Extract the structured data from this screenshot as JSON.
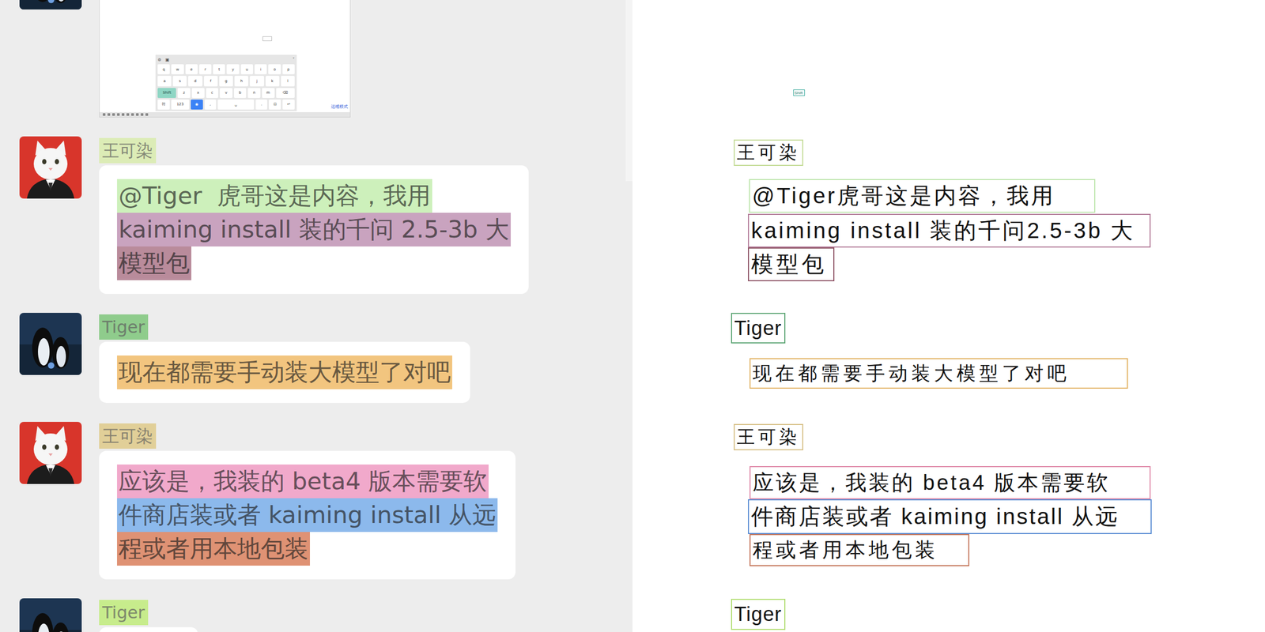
{
  "chat": {
    "messages": [
      {
        "kind": "image",
        "avatar": "penguin",
        "image": {
          "keyboard": {
            "toolbar": [
              "⊚",
              "▣",
              "˅"
            ],
            "rows": [
              {
                "keys": [
                  {
                    "label": "q"
                  },
                  {
                    "label": "w"
                  },
                  {
                    "label": "e"
                  },
                  {
                    "label": "r"
                  },
                  {
                    "label": "t"
                  },
                  {
                    "label": "y"
                  },
                  {
                    "label": "u"
                  },
                  {
                    "label": "i"
                  },
                  {
                    "label": "o"
                  },
                  {
                    "label": "p"
                  }
                ]
              },
              {
                "keys": [
                  {
                    "label": "a"
                  },
                  {
                    "label": "s"
                  },
                  {
                    "label": "d"
                  },
                  {
                    "label": "f"
                  },
                  {
                    "label": "g"
                  },
                  {
                    "label": "h"
                  },
                  {
                    "label": "j"
                  },
                  {
                    "label": "k"
                  },
                  {
                    "label": "l"
                  }
                ]
              },
              {
                "keys": [
                  {
                    "label": "Shift",
                    "color": "#8fd6c4"
                  },
                  {
                    "label": "z"
                  },
                  {
                    "label": "x"
                  },
                  {
                    "label": "c"
                  },
                  {
                    "label": "v"
                  },
                  {
                    "label": "b"
                  },
                  {
                    "label": "n"
                  },
                  {
                    "label": "m"
                  },
                  {
                    "label": "⌫"
                  }
                ]
              },
              {
                "keys": [
                  {
                    "label": "符"
                  },
                  {
                    "label": "123"
                  },
                  {
                    "label": "◉",
                    "color": "#3b82f6"
                  },
                  {
                    "label": ","
                  },
                  {
                    "label": "␣"
                  },
                  {
                    "label": "."
                  },
                  {
                    "label": "⊡"
                  },
                  {
                    "label": "↩"
                  }
                ]
              }
            ]
          },
          "mode_label": "运维模式"
        }
      },
      {
        "kind": "text",
        "avatar": "cat",
        "name": {
          "text": "王可染",
          "highlight": "#dcecb6"
        },
        "lines": [
          {
            "text": "@Tiger  虎哥这是内容，我用",
            "highlight": "#cdf0bb"
          },
          {
            "text": "kaiming install 装的千问 2.5-3b 大",
            "highlight": "#c9a3bf"
          },
          {
            "text": "模型包",
            "highlight": "#b98b9b"
          }
        ]
      },
      {
        "kind": "text",
        "avatar": "penguin",
        "name": {
          "text": "Tiger",
          "highlight": "#8fcc8c"
        },
        "lines": [
          {
            "text": "现在都需要手动装大模型了对吧",
            "highlight": "#f2c57f"
          }
        ]
      },
      {
        "kind": "text",
        "avatar": "cat",
        "name": {
          "text": "王可染",
          "highlight": "#e1cf98"
        },
        "lines": [
          {
            "text": "应该是，我装的 beta4 版本需要软",
            "highlight": "#f1a9cb"
          },
          {
            "text": "件商店装或者 kaiming install 从远",
            "highlight": "#8cb9ec"
          },
          {
            "text": "程或者用本地包装",
            "highlight": "#df9274"
          }
        ]
      },
      {
        "kind": "text",
        "avatar": "penguin",
        "name": {
          "text": "Tiger",
          "highlight": "#c7ec8c"
        },
        "lines": []
      }
    ]
  },
  "ocr": {
    "items": [
      {
        "text": "Shift",
        "color": "#35a99a"
      },
      {
        "text": "王可染",
        "color": "#c5dc98"
      },
      {
        "text": "@Tiger虎哥这是内容，我用",
        "color": "#bfe6ae"
      },
      {
        "text": "kaiming install 装的千问2.5-3b 大",
        "color": "#b47d9a"
      },
      {
        "text": "模型包",
        "color": "#8f5566"
      },
      {
        "text": "Tiger",
        "color": "#5fa776"
      },
      {
        "text": "现在都需要手动装大模型了对吧",
        "color": "#e3b568"
      },
      {
        "text": "王可染",
        "color": "#d7c188"
      },
      {
        "text": "应该是，我装的 beta4 版本需要软",
        "color": "#e08cab"
      },
      {
        "text": "件商店装或者 kaiming install 从远",
        "color": "#5d8fd4"
      },
      {
        "text": "程或者用本地包装",
        "color": "#c4765a"
      },
      {
        "text": "Tiger",
        "color": "#b2dd72"
      }
    ]
  }
}
